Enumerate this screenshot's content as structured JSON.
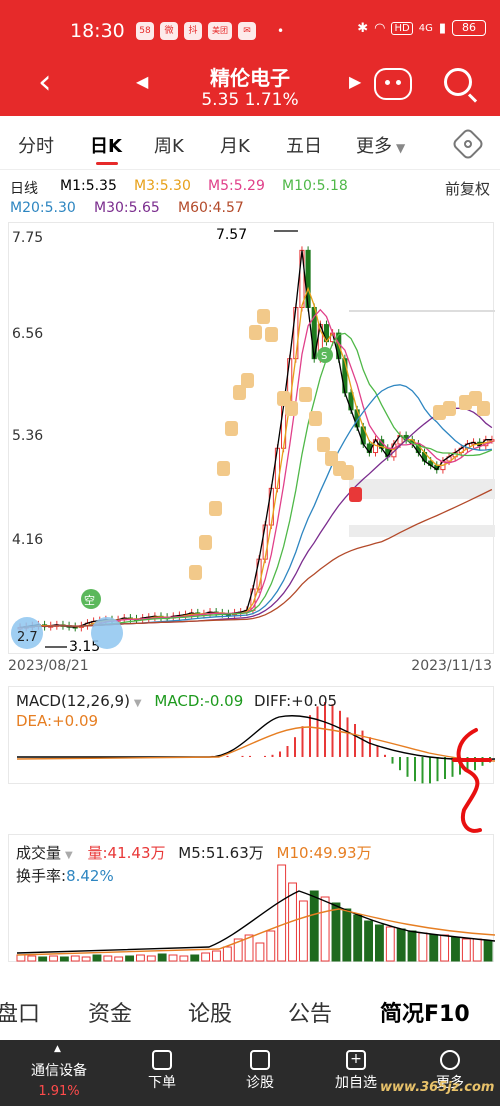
{
  "status": {
    "time": "18:30",
    "apps": [
      "58",
      "微",
      "抖",
      "美团",
      "✉"
    ],
    "dot": "•",
    "signal": "4G",
    "hd": "HD",
    "battery": "86"
  },
  "header": {
    "stock_name": "精伦电子",
    "price_line": "5.35 1.71%",
    "back_icon": "chevron-left-icon",
    "prev_icon": "triangle-left-icon",
    "next_icon": "triangle-right-icon"
  },
  "tabs": [
    {
      "label": "分时"
    },
    {
      "label": "日K"
    },
    {
      "label": "周K"
    },
    {
      "label": "月K"
    },
    {
      "label": "五日"
    }
  ],
  "more_tab": {
    "label": "更多",
    "caret": "▼"
  },
  "ma": {
    "label": "日线",
    "m1": "M1:5.35",
    "m3": "M3:5.30",
    "m5": "M5:5.29",
    "m10": "M10:5.18",
    "m20": "M20:5.30",
    "m30": "M30:5.65",
    "m60": "M60:4.57",
    "adjust": "前复权"
  },
  "colors": {
    "up": "#e83838",
    "down": "#1e7a1e",
    "m1": "#000000",
    "m3": "#e7a11a",
    "m5": "#e0408a",
    "m10": "#4fb848",
    "m20": "#2e86c1",
    "m30": "#7b2d8e",
    "m60": "#b34a2a"
  },
  "price_axis": [
    "7.75",
    "6.56",
    "5.36",
    "4.16"
  ],
  "annotations": {
    "high": "7.57",
    "low": "3.15",
    "low_short": "2.7",
    "empty_badge": "空",
    "badge_s": "S"
  },
  "dates": {
    "start": "2023/08/21",
    "end": "2023/11/13"
  },
  "macd": {
    "title": "MACD(12,26,9)",
    "macd": "MACD:-0.09",
    "diff": "DIFF:+0.05",
    "dea": "DEA:+0.09"
  },
  "volume": {
    "title": "成交量",
    "liang": "量:41.43万",
    "m5": "M5:51.63万",
    "m10": "M10:49.93万",
    "turnover_label": "换手率:",
    "turnover_value": "8.42%"
  },
  "section_tabs": [
    {
      "label": "盘口"
    },
    {
      "label": "资金"
    },
    {
      "label": "论股"
    },
    {
      "label": "公告"
    },
    {
      "label": "简况F10"
    }
  ],
  "bottom": {
    "sector_name": "通信设备",
    "sector_change": "1.91%",
    "items": [
      {
        "label": "下单",
        "icon": "document-icon"
      },
      {
        "label": "诊股",
        "icon": "stethoscope-icon"
      },
      {
        "label": "加自选",
        "icon": "plus-icon"
      },
      {
        "label": "更多",
        "icon": "menu-icon"
      }
    ],
    "watermark": "www.365jz.com"
  }
}
